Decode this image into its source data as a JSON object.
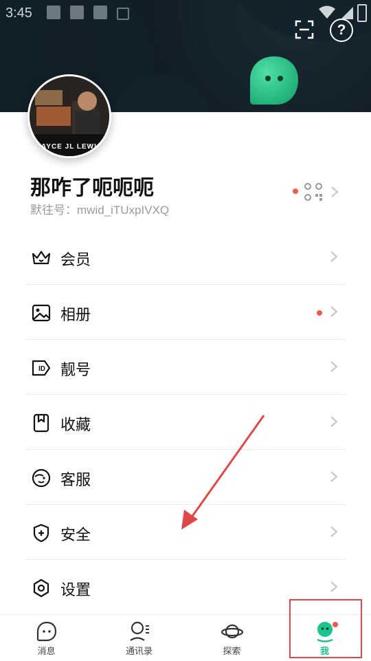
{
  "status_bar": {
    "time": "3:45"
  },
  "header": {
    "scan_icon": "scan-icon",
    "help_label": "?"
  },
  "profile": {
    "avatar_caption": "JAYCE JL LEWIS",
    "name": "那咋了呃呃呃",
    "id_text": "默往号：mwid_iTUxpIVXQ"
  },
  "menu": [
    {
      "label": "会员",
      "icon": "crown-icon",
      "has_dot": false
    },
    {
      "label": "相册",
      "icon": "image-icon",
      "has_dot": true
    },
    {
      "label": "靓号",
      "icon": "id-tag-icon",
      "has_dot": false
    },
    {
      "label": "收藏",
      "icon": "bookmark-icon",
      "has_dot": false
    },
    {
      "label": "客服",
      "icon": "customer-service-icon",
      "has_dot": false
    },
    {
      "label": "安全",
      "icon": "shield-icon",
      "has_dot": false
    },
    {
      "label": "设置",
      "icon": "settings-icon",
      "has_dot": false
    }
  ],
  "tabs": [
    {
      "label": "消息",
      "icon": "message-icon"
    },
    {
      "label": "通讯录",
      "icon": "contacts-icon"
    },
    {
      "label": "探索",
      "icon": "planet-icon"
    },
    {
      "label": "我",
      "icon": "me-icon",
      "active": true
    }
  ],
  "colors": {
    "accent": "#1ec48d",
    "red_dot": "#ef5c4e",
    "annotation": "#e04848"
  }
}
